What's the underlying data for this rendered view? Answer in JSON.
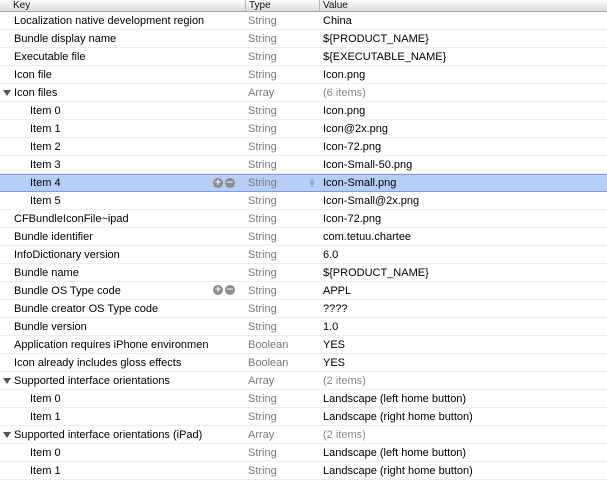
{
  "header": {
    "key": "Key",
    "type": "Type",
    "value": "Value"
  },
  "controls": {
    "add": "+",
    "remove": "−",
    "stepper_up": "▲",
    "stepper_down": "▼"
  },
  "rows": [
    {
      "key": "Localization native development region",
      "type": "String",
      "value": "China"
    },
    {
      "key": "Bundle display name",
      "type": "String",
      "value": "${PRODUCT_NAME}"
    },
    {
      "key": "Executable file",
      "type": "String",
      "value": "${EXECUTABLE_NAME}"
    },
    {
      "key": "Icon file",
      "type": "String",
      "value": "Icon.png"
    },
    {
      "key": "Icon files",
      "type": "Array",
      "value": "(6 items)"
    },
    {
      "key": "Item 0",
      "type": "String",
      "value": "Icon.png"
    },
    {
      "key": "Item 1",
      "type": "String",
      "value": "Icon@2x.png"
    },
    {
      "key": "Item 2",
      "type": "String",
      "value": "Icon-72.png"
    },
    {
      "key": "Item 3",
      "type": "String",
      "value": "Icon-Small-50.png"
    },
    {
      "key": "Item 4",
      "type": "String",
      "value": "Icon-Small.png"
    },
    {
      "key": "Item 5",
      "type": "String",
      "value": "Icon-Small@2x.png"
    },
    {
      "key": "CFBundleIconFile~ipad",
      "type": "String",
      "value": "Icon-72.png"
    },
    {
      "key": "Bundle identifier",
      "type": "String",
      "value": "com.tetuu.chartee"
    },
    {
      "key": "InfoDictionary version",
      "type": "String",
      "value": "6.0"
    },
    {
      "key": "Bundle name",
      "type": "String",
      "value": "${PRODUCT_NAME}"
    },
    {
      "key": "Bundle OS Type code",
      "type": "String",
      "value": "APPL"
    },
    {
      "key": "Bundle creator OS Type code",
      "type": "String",
      "value": "????"
    },
    {
      "key": "Bundle version",
      "type": "String",
      "value": "1.0"
    },
    {
      "key": "Application requires iPhone environmen",
      "type": "Boolean",
      "value": "YES"
    },
    {
      "key": "Icon already includes gloss effects",
      "type": "Boolean",
      "value": "YES"
    },
    {
      "key": "Supported interface orientations",
      "type": "Array",
      "value": "(2 items)"
    },
    {
      "key": "Item 0",
      "type": "String",
      "value": "Landscape (left home button)"
    },
    {
      "key": "Item 1",
      "type": "String",
      "value": "Landscape (right home button)"
    },
    {
      "key": "Supported interface orientations (iPad)",
      "type": "Array",
      "value": "(2 items)"
    },
    {
      "key": "Item 0",
      "type": "String",
      "value": "Landscape (left home button)"
    },
    {
      "key": "Item 1",
      "type": "String",
      "value": "Landscape (right home button)"
    }
  ]
}
